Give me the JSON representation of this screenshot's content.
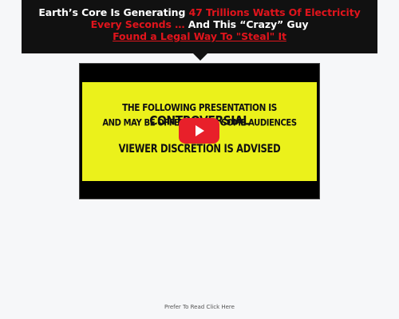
{
  "headline": {
    "part1": "Earth’s Core Is Generating ",
    "part2_red": "47 Trillions Watts Of Electricity Every Seconds …",
    "part3": " And This “Crazy” Guy",
    "link_text": "Found a Legal Way To \"Steal\" It",
    "colors": {
      "background": "#111111",
      "accent": "#e0141c",
      "text": "#ffffff"
    }
  },
  "video": {
    "slide": {
      "line1_prefix": "THE FOLLOWING PRESENTATION IS ",
      "line1_emphasis": "CONTROVERSIAL",
      "line2": "AND MAY BE OFFENSIVE TO SOME AUDIENCES",
      "line3": "VIEWER DISCRETION IS ADVISED",
      "background_color": "#ebf11b"
    },
    "play_icon": "play-icon",
    "play_color": "#e8202a"
  },
  "footer": {
    "read_link": "Prefer To Read Click Here"
  }
}
